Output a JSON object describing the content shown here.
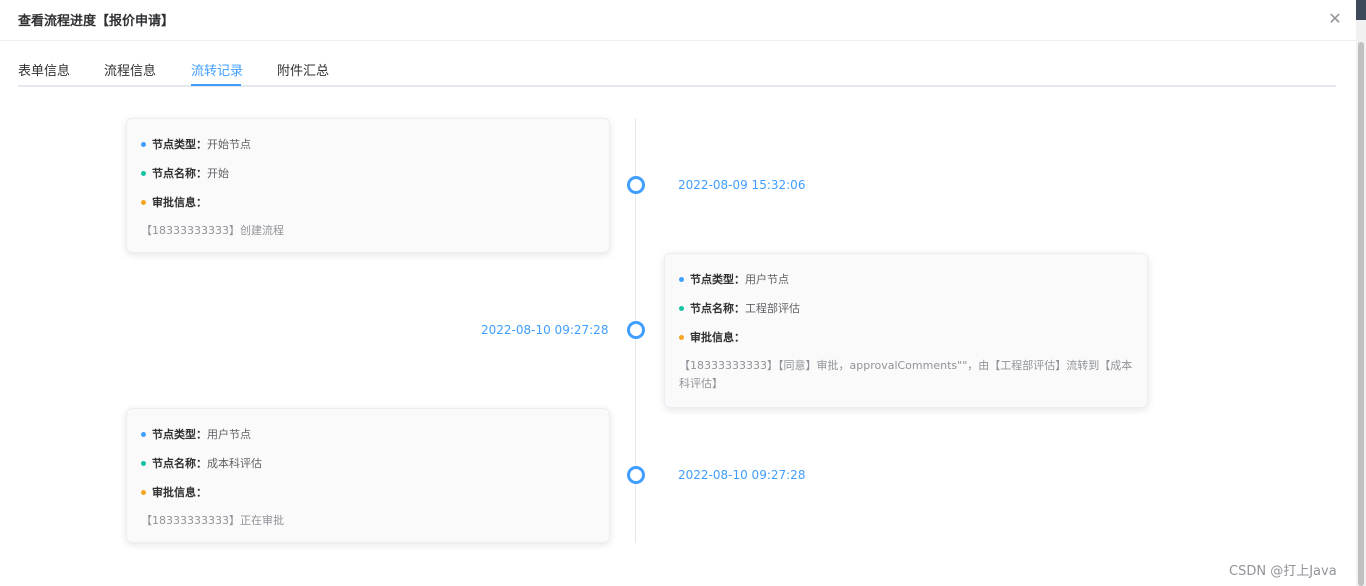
{
  "dialog": {
    "title": "查看流程进度【报价申请】"
  },
  "tabs": [
    {
      "label": "表单信息"
    },
    {
      "label": "流程信息"
    },
    {
      "label": "流转记录"
    },
    {
      "label": "附件汇总"
    }
  ],
  "timeline": [
    {
      "time": "2022-08-09 15:32:06",
      "node_type_label": "节点类型：",
      "node_type": "开始节点",
      "node_name_label": "节点名称：",
      "node_name": "开始",
      "approval_label": "审批信息：",
      "approval": "【18333333333】创建流程"
    },
    {
      "time": "2022-08-10 09:27:28",
      "node_type_label": "节点类型：",
      "node_type": "用户节点",
      "node_name_label": "节点名称：",
      "node_name": "工程部评估",
      "approval_label": "审批信息：",
      "approval": "【18333333333】【同意】审批，approvalComments\"\"，由【工程部评估】流转到【成本科评估】"
    },
    {
      "time": "2022-08-10 09:27:28",
      "node_type_label": "节点类型：",
      "node_type": "用户节点",
      "node_name_label": "节点名称：",
      "node_name": "成本科评估",
      "approval_label": "审批信息：",
      "approval": "【18333333333】正在审批"
    }
  ],
  "colors": {
    "accent": "#409eff",
    "dot_type": "#409eff",
    "dot_name": "#13c2a3",
    "dot_approval": "#f5a623"
  },
  "watermark": "CSDN @打上Java"
}
